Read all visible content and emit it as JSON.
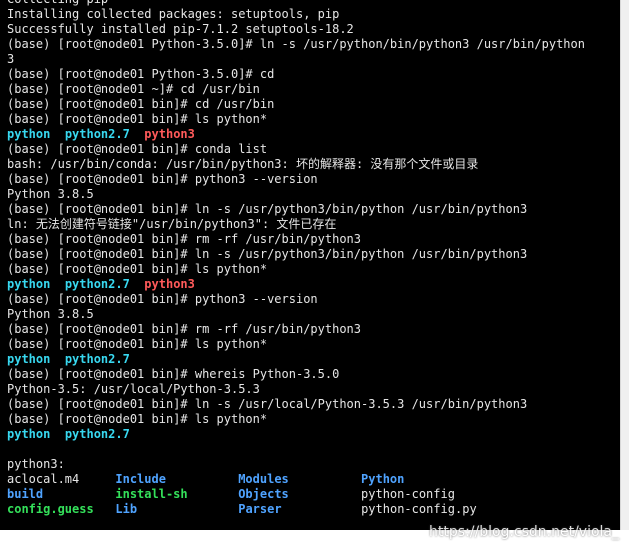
{
  "terminal": {
    "colors": {
      "default": "#e6e6e6",
      "cyan": "#38d8f0",
      "red": "#ff5a5a",
      "green": "#34e05a",
      "blue": "#4fa3ff",
      "background": "#000000"
    },
    "lines": [
      [
        {
          "t": "Collecting pip",
          "c": "default"
        }
      ],
      [
        {
          "t": "Installing collected packages: setuptools, pip",
          "c": "default"
        }
      ],
      [
        {
          "t": "Successfully installed pip-7.1.2 setuptools-18.2",
          "c": "default"
        }
      ],
      [
        {
          "t": "(base) [root@node01 Python-3.5.0]# ln -s /usr/python/bin/python3 /usr/bin/python",
          "c": "default"
        }
      ],
      [
        {
          "t": "3",
          "c": "default"
        }
      ],
      [
        {
          "t": "(base) [root@node01 Python-3.5.0]# cd",
          "c": "default"
        }
      ],
      [
        {
          "t": "(base) [root@node01 ~]# cd /usr/bin",
          "c": "default"
        }
      ],
      [
        {
          "t": "(base) [root@node01 bin]# cd /usr/bin",
          "c": "default"
        }
      ],
      [
        {
          "t": "(base) [root@node01 bin]# ls python*",
          "c": "default"
        }
      ],
      [
        {
          "t": "python",
          "c": "cyan",
          "b": true
        },
        {
          "t": "  ",
          "c": "default"
        },
        {
          "t": "python2.7",
          "c": "cyan",
          "b": true
        },
        {
          "t": "  ",
          "c": "default"
        },
        {
          "t": "python3",
          "c": "red",
          "b": true
        }
      ],
      [
        {
          "t": "(base) [root@node01 bin]# conda list",
          "c": "default"
        }
      ],
      [
        {
          "t": "bash: /usr/bin/conda: /usr/bin/python3: 坏的解释器: 没有那个文件或目录",
          "c": "default"
        }
      ],
      [
        {
          "t": "(base) [root@node01 bin]# python3 --version",
          "c": "default"
        }
      ],
      [
        {
          "t": "Python 3.8.5",
          "c": "default"
        }
      ],
      [
        {
          "t": "(base) [root@node01 bin]# ln -s /usr/python3/bin/python /usr/bin/python3",
          "c": "default"
        }
      ],
      [
        {
          "t": "ln: 无法创建符号链接\"/usr/bin/python3\": 文件已存在",
          "c": "default"
        }
      ],
      [
        {
          "t": "(base) [root@node01 bin]# rm -rf /usr/bin/python3",
          "c": "default"
        }
      ],
      [
        {
          "t": "(base) [root@node01 bin]# ln -s /usr/python3/bin/python /usr/bin/python3",
          "c": "default"
        }
      ],
      [
        {
          "t": "(base) [root@node01 bin]# ls python*",
          "c": "default"
        }
      ],
      [
        {
          "t": "python",
          "c": "cyan",
          "b": true
        },
        {
          "t": "  ",
          "c": "default"
        },
        {
          "t": "python2.7",
          "c": "cyan",
          "b": true
        },
        {
          "t": "  ",
          "c": "default"
        },
        {
          "t": "python3",
          "c": "red",
          "b": true
        }
      ],
      [
        {
          "t": "(base) [root@node01 bin]# python3 --version",
          "c": "default"
        }
      ],
      [
        {
          "t": "Python 3.8.5",
          "c": "default"
        }
      ],
      [
        {
          "t": "(base) [root@node01 bin]# rm -rf /usr/bin/python3",
          "c": "default"
        }
      ],
      [
        {
          "t": "(base) [root@node01 bin]# ls python*",
          "c": "default"
        }
      ],
      [
        {
          "t": "python",
          "c": "cyan",
          "b": true
        },
        {
          "t": "  ",
          "c": "default"
        },
        {
          "t": "python2.7",
          "c": "cyan",
          "b": true
        }
      ],
      [
        {
          "t": "(base) [root@node01 bin]# whereis Python-3.5.0",
          "c": "default"
        }
      ],
      [
        {
          "t": "Python-3.5: /usr/local/Python-3.5.3",
          "c": "default"
        }
      ],
      [
        {
          "t": "(base) [root@node01 bin]# ln -s /usr/local/Python-3.5.3 /usr/bin/python3",
          "c": "default"
        }
      ],
      [
        {
          "t": "(base) [root@node01 bin]# ls python*",
          "c": "default"
        }
      ],
      [
        {
          "t": "python",
          "c": "cyan",
          "b": true
        },
        {
          "t": "  ",
          "c": "default"
        },
        {
          "t": "python2.7",
          "c": "cyan",
          "b": true
        }
      ],
      [
        {
          "t": "",
          "c": "default"
        }
      ],
      [
        {
          "t": "python3:",
          "c": "default"
        }
      ],
      [
        {
          "t": "aclocal.m4     ",
          "c": "default"
        },
        {
          "t": "Include",
          "c": "blue",
          "b": true
        },
        {
          "t": "          ",
          "c": "default"
        },
        {
          "t": "Modules",
          "c": "blue",
          "b": true
        },
        {
          "t": "          ",
          "c": "default"
        },
        {
          "t": "Python",
          "c": "blue",
          "b": true
        }
      ],
      [
        {
          "t": "build",
          "c": "blue",
          "b": true
        },
        {
          "t": "          ",
          "c": "default"
        },
        {
          "t": "install-sh",
          "c": "green",
          "b": true
        },
        {
          "t": "       ",
          "c": "default"
        },
        {
          "t": "Objects",
          "c": "blue",
          "b": true
        },
        {
          "t": "          ",
          "c": "default"
        },
        {
          "t": "python-config",
          "c": "default"
        }
      ],
      [
        {
          "t": "config.guess",
          "c": "green",
          "b": true
        },
        {
          "t": "   ",
          "c": "default"
        },
        {
          "t": "Lib",
          "c": "blue",
          "b": true
        },
        {
          "t": "              ",
          "c": "default"
        },
        {
          "t": "Parser",
          "c": "blue",
          "b": true
        },
        {
          "t": "           ",
          "c": "default"
        },
        {
          "t": "python-config.py",
          "c": "default"
        }
      ]
    ]
  },
  "watermark": "https://blog.csdn.net/viola_"
}
